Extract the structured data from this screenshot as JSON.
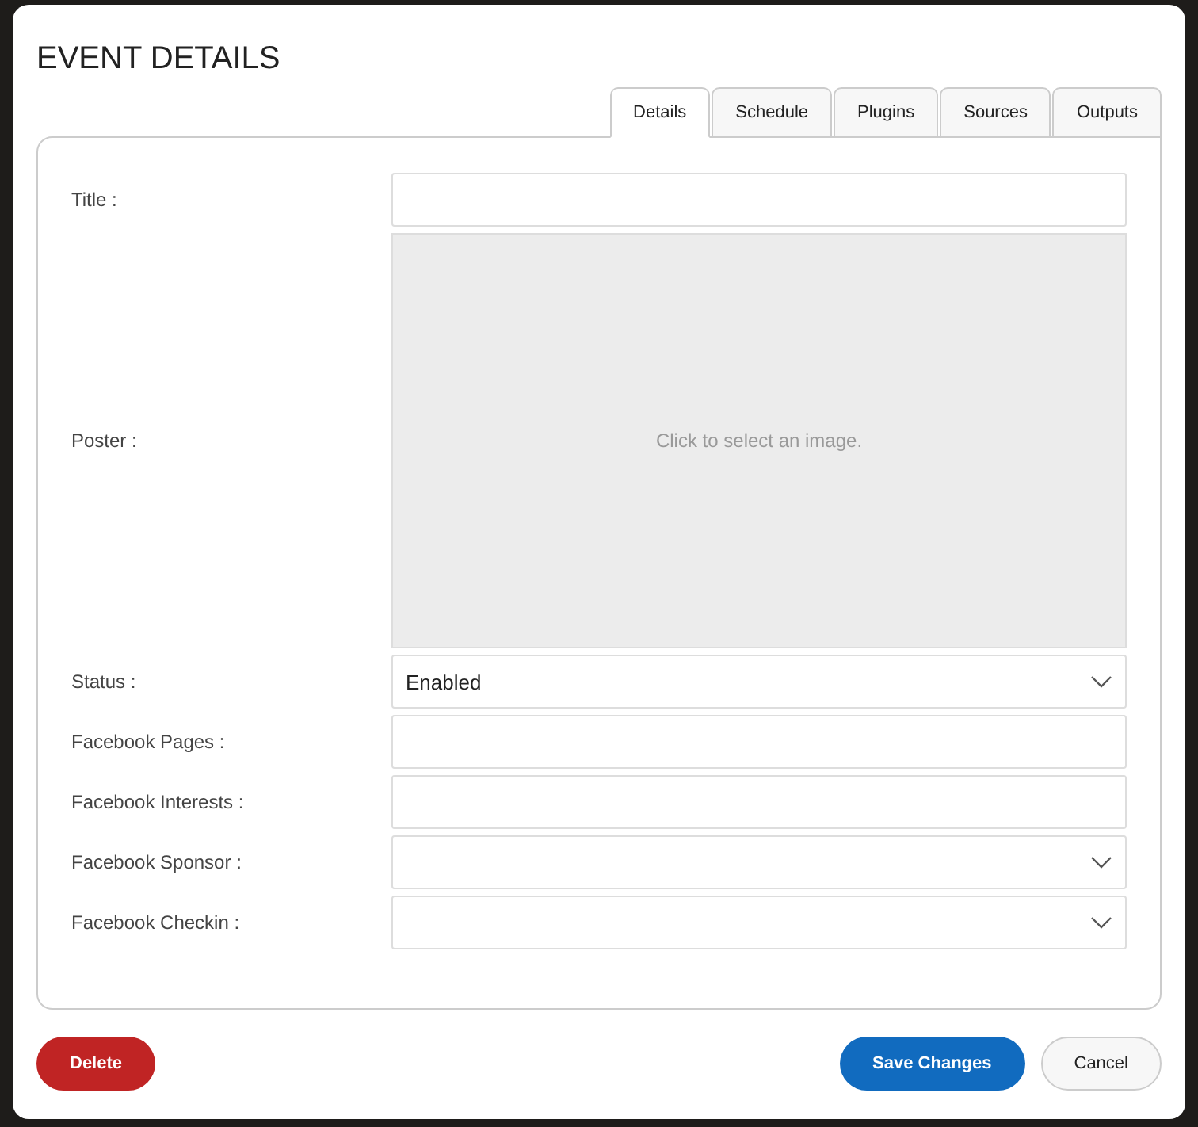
{
  "dialog": {
    "title": "EVENT DETAILS"
  },
  "tabs": [
    {
      "label": "Details",
      "selected": true
    },
    {
      "label": "Schedule",
      "selected": false
    },
    {
      "label": "Plugins",
      "selected": false
    },
    {
      "label": "Sources",
      "selected": false
    },
    {
      "label": "Outputs",
      "selected": false
    }
  ],
  "fields": [
    {
      "label": "Title :",
      "kind": "text"
    },
    {
      "label": "Poster :",
      "kind": "image",
      "prompt": "Click to select an image."
    },
    {
      "label": "Status :",
      "kind": "select",
      "value": "Enabled"
    },
    {
      "label": "Facebook Pages :",
      "kind": "text"
    },
    {
      "label": "Facebook Interests :",
      "kind": "text"
    },
    {
      "label": "Facebook Sponsor :",
      "kind": "select"
    },
    {
      "label": "Facebook Checkin :",
      "kind": "select"
    }
  ],
  "buttons": [
    {
      "label": "Delete",
      "kind": "danger"
    },
    {
      "label": "Save Changes",
      "kind": "primary"
    },
    {
      "label": "Cancel",
      "kind": "default"
    }
  ]
}
